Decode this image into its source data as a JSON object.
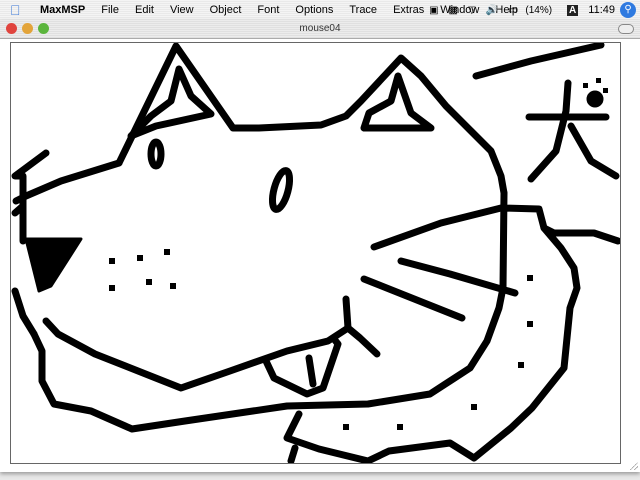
{
  "menubar": {
    "app_name": "MaxMSP",
    "items": [
      "File",
      "Edit",
      "View",
      "Object",
      "Font",
      "Options",
      "Trace",
      "Extras",
      "Window",
      "Help"
    ],
    "battery": "(14%)",
    "input_menu": "A",
    "clock": "11:49"
  },
  "window": {
    "title": "mouse04"
  }
}
